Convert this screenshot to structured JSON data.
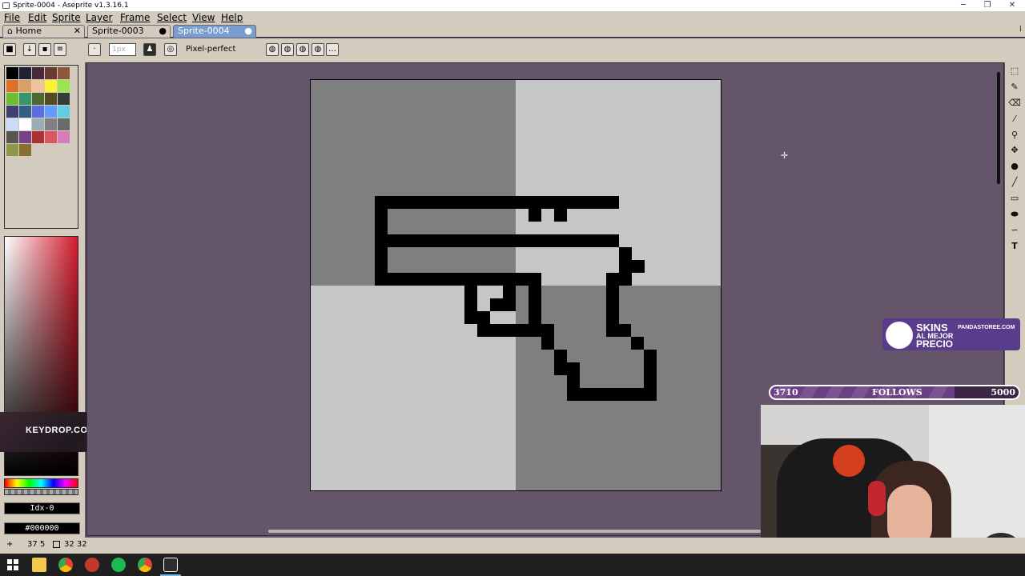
{
  "window": {
    "title": "Sprite-0004 - Aseprite v1.3.16.1"
  },
  "menu": [
    "File",
    "Edit",
    "Sprite",
    "Layer",
    "Frame",
    "Select",
    "View",
    "Help"
  ],
  "tabs": [
    {
      "label": "Home"
    },
    {
      "label": "Sprite-0003"
    },
    {
      "label": "Sprite-0004"
    }
  ],
  "toolbar": {
    "brush_size_placeholder": "1px",
    "pixel_perfect_label": "Pixel-perfect"
  },
  "colors": {
    "fg_index": "Idx-0",
    "fg_hex": "#000000",
    "palette": [
      "#000000",
      "#222034",
      "#45283c",
      "#663931",
      "#8f563b",
      "#df7126",
      "#d9a066",
      "#eec39a",
      "#fbf236",
      "#99e550",
      "#6abe30",
      "#37946e",
      "#4b692f",
      "#524b24",
      "#323c39",
      "#3f3f74",
      "#306082",
      "#5b6ee1",
      "#639bff",
      "#5fcde4",
      "#cbdbfc",
      "#ffffff",
      "#9badb7",
      "#847e87",
      "#696a6a",
      "#595652",
      "#76428a",
      "#ac3232",
      "#d95763",
      "#d77bba",
      "#8f974a",
      "#8a6f30"
    ],
    "canvas_bg": "#65556b",
    "checker_dark": "#7f7f7f",
    "checker_light": "#c6c6c6"
  },
  "status": {
    "position": "37 5",
    "size": "32 32"
  },
  "overlays": {
    "keydrop": "KEYDROP.COM",
    "skins_title": "SKINS",
    "skins_sub1": "AL MEJOR",
    "skins_sub2": "PRECIO",
    "skins_site": "PANDASTOREE.COM",
    "follows_current": "3710",
    "follows_label": "FOLLOWS",
    "follows_goal": "5000",
    "follows_progress": 0.742
  }
}
